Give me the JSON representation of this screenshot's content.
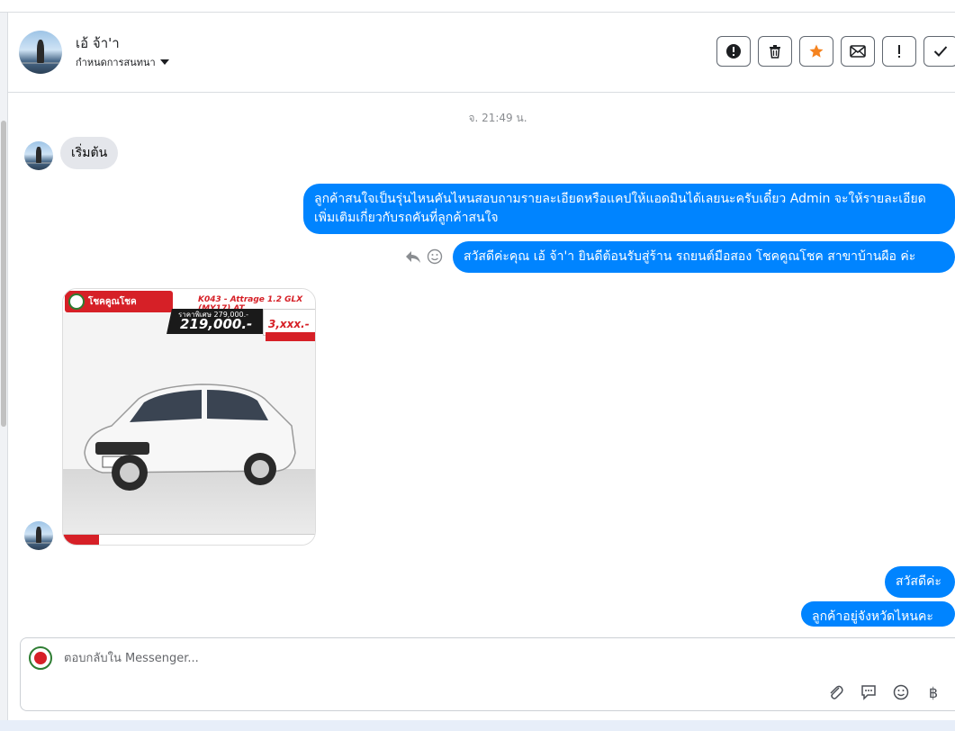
{
  "header": {
    "contact_name": "เอ้ จ้า'า",
    "assign_label": "กำหนดการสนทนา",
    "actions": [
      {
        "name": "spam-button",
        "icon": "exclamation-circle-icon"
      },
      {
        "name": "delete-button",
        "icon": "trash-icon"
      },
      {
        "name": "star-button",
        "icon": "star-icon"
      },
      {
        "name": "mark-unread-button",
        "icon": "envelope-icon"
      },
      {
        "name": "follow-up-button",
        "icon": "exclamation-icon"
      },
      {
        "name": "done-button",
        "icon": "check-icon"
      }
    ]
  },
  "conversation": {
    "timestamp": "จ. 21:49 น.",
    "msg_in_1": "เริ่มต้น",
    "msg_out_1": "ลูกค้าสนใจเป็นรุ่นไหนคันไหนสอบถามรายละเอียดหรือแคปให้แอดมินได้เลยนะครับเดี๋ยว Admin จะให้รายละเอียดเพิ่มเติมเกี่ยวกับรถคันที่ลูกค้าสนใจ",
    "msg_out_2": "สวัสดีค่ะคุณ เอ้ จ้า'า ยินดีต้อนรับสู่ร้าน รถยนต์มือสอง โชคคูณโชค สาขาบ้านผือ ค่ะ",
    "msg_out_3": "สวัสดีค่ะ",
    "msg_out_4": "ลูกค้าอยู่จังหวัดไหนคะ",
    "image": {
      "logo_text": "โชคคูณโชค",
      "model": "K043 - Attrage 1.2 GLX (MY17) AT",
      "price_label": "ราคาพิเศษ 279,000.-",
      "price": "219,000.-",
      "monthly": "3,xxx.-"
    }
  },
  "composer": {
    "placeholder": "ตอบกลับใน Messenger...",
    "tools": [
      "paperclip-icon",
      "chat-icon",
      "emoji-icon",
      "baht-icon"
    ]
  }
}
